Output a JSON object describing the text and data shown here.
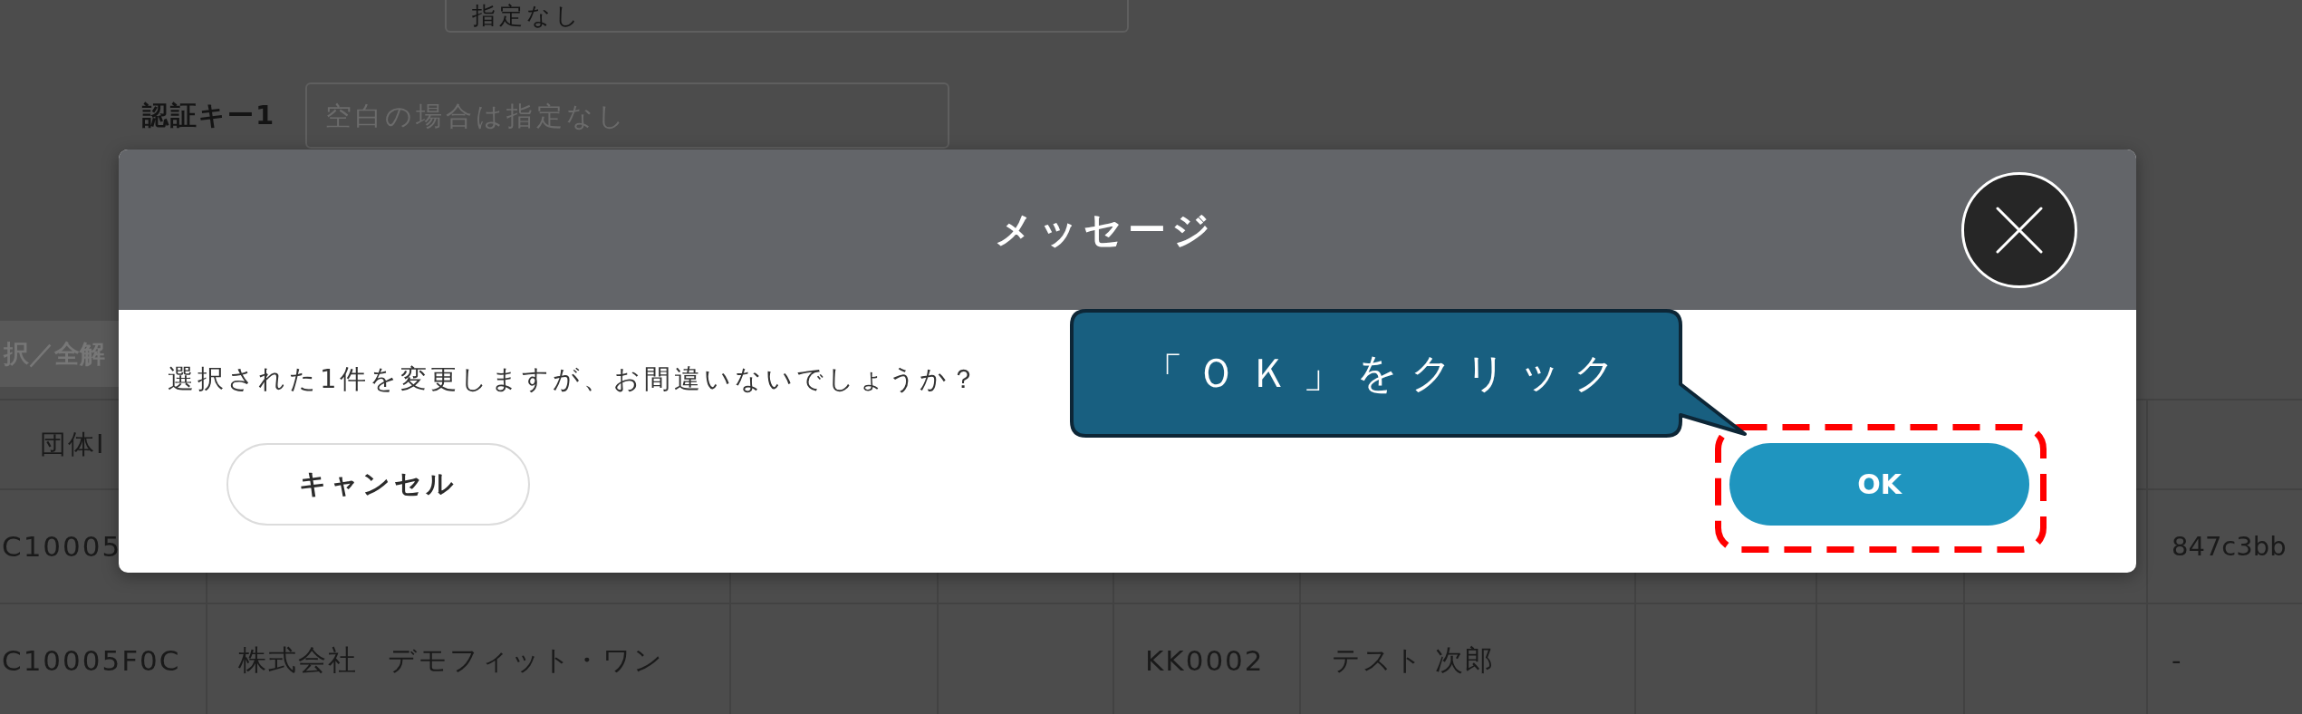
{
  "filter_form": {
    "fields": [
      {
        "value": "指定なし"
      },
      {
        "label": "認証キー1",
        "placeholder": "空白の場合は指定なし"
      }
    ]
  },
  "toolbar": {
    "select_button": "択／全解"
  },
  "table": {
    "columns": [
      "団体I"
    ],
    "rows": [
      {
        "column_1": "C10005",
        "column_10": "847c3bb"
      },
      {
        "column_1": "C10005F0C",
        "column_2": "株式会社　デモフィット・ワン",
        "column_5": "KK0002",
        "column_6": "テスト 次郎",
        "column_10": "-"
      }
    ]
  },
  "dialog": {
    "title": "メッセージ",
    "message": "選択された1件を変更しますが、お間違いないでしょうか？",
    "buttons": [
      {
        "label": "キャンセル",
        "kind": "secondary",
        "highlighted": false
      },
      {
        "label": "OK",
        "kind": "primary",
        "highlighted": true
      }
    ]
  },
  "callout": {
    "text": "「ＯＫ」をクリック"
  }
}
